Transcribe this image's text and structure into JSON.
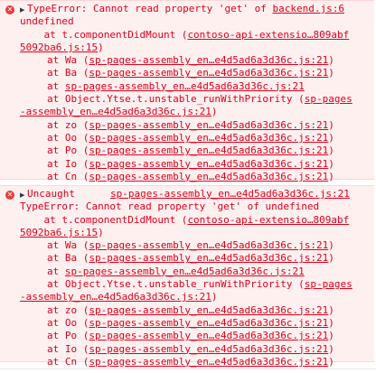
{
  "colors": {
    "error_text": "#e0001b",
    "error_bg": "#fff0f0",
    "error_border": "#ffd6d6",
    "icon_bg": "#ef3939"
  },
  "messages": [
    {
      "icon": "error-icon",
      "header_prefix": "TypeError: Cannot read property 'get' of ",
      "header_source": "backend.js:6",
      "header_line2": "undefined",
      "frames": [
        {
          "text": "    at t.componentDidMount (",
          "link": "contoso-api-extensio…809abf5092ba6.js:15",
          "close": ")",
          "wrap": true,
          "link_a": "contoso-api-extensio…809abf",
          "link_b": "5092ba6.js:15"
        },
        {
          "text": "at Wa (",
          "link": "sp-pages-assembly_en…e4d5ad6a3d36c.js:21",
          "close": ")"
        },
        {
          "text": "at Ba (",
          "link": "sp-pages-assembly_en…e4d5ad6a3d36c.js:21",
          "close": ")"
        },
        {
          "text": "at ",
          "link": "sp-pages-assembly_en…e4d5ad6a3d36c.js:21",
          "close": ""
        },
        {
          "text": "at Object.Ytse.t.unstable_runWithPriority (",
          "link": "sp-pages-assembly_en…e4d5ad6a3d36c.js:21",
          "close": ")",
          "wrap2": true,
          "link_a": "sp-pages",
          "link_b": "-assembly_en…e4d5ad6a3d36c.js:21"
        },
        {
          "text": "at zo (",
          "link": "sp-pages-assembly_en…e4d5ad6a3d36c.js:21",
          "close": ")"
        },
        {
          "text": "at Oo (",
          "link": "sp-pages-assembly_en…e4d5ad6a3d36c.js:21",
          "close": ")"
        },
        {
          "text": "at Po (",
          "link": "sp-pages-assembly_en…e4d5ad6a3d36c.js:21",
          "close": ")"
        },
        {
          "text": "at Io (",
          "link": "sp-pages-assembly_en…e4d5ad6a3d36c.js:21",
          "close": ")"
        },
        {
          "text": "at Cn (",
          "link": "sp-pages-assembly_en…e4d5ad6a3d36c.js:21",
          "close": ")"
        }
      ]
    },
    {
      "icon": "error-icon",
      "header_prefix": "Uncaught",
      "header_source": "sp-pages-assembly_en…e4d5ad6a3d36c.js:21",
      "header_line2": "TypeError: Cannot read property 'get' of undefined",
      "frames": [
        {
          "text": "    at t.componentDidMount (",
          "link_a": "contoso-api-extensio…809abf",
          "link_b": "5092ba6.js:15",
          "close": ")"
        },
        {
          "text": "at Wa (",
          "link": "sp-pages-assembly_en…e4d5ad6a3d36c.js:21",
          "close": ")"
        },
        {
          "text": "at Ba (",
          "link": "sp-pages-assembly_en…e4d5ad6a3d36c.js:21",
          "close": ")"
        },
        {
          "text": "at ",
          "link": "sp-pages-assembly_en…e4d5ad6a3d36c.js:21",
          "close": ""
        },
        {
          "text": "at Object.Ytse.t.unstable_runWithPriority (",
          "link_a": "sp-pages",
          "link_b": "-assembly_en…e4d5ad6a3d36c.js:21",
          "close": ")"
        },
        {
          "text": "at zo (",
          "link": "sp-pages-assembly_en…e4d5ad6a3d36c.js:21",
          "close": ")"
        },
        {
          "text": "at Oo (",
          "link": "sp-pages-assembly_en…e4d5ad6a3d36c.js:21",
          "close": ")"
        },
        {
          "text": "at Po (",
          "link": "sp-pages-assembly_en…e4d5ad6a3d36c.js:21",
          "close": ")"
        },
        {
          "text": "at Io (",
          "link": "sp-pages-assembly_en…e4d5ad6a3d36c.js:21",
          "close": ")"
        },
        {
          "text": "at Cn (",
          "link": "sp-pages-assembly_en…e4d5ad6a3d36c.js:21",
          "close": ")"
        }
      ]
    }
  ]
}
